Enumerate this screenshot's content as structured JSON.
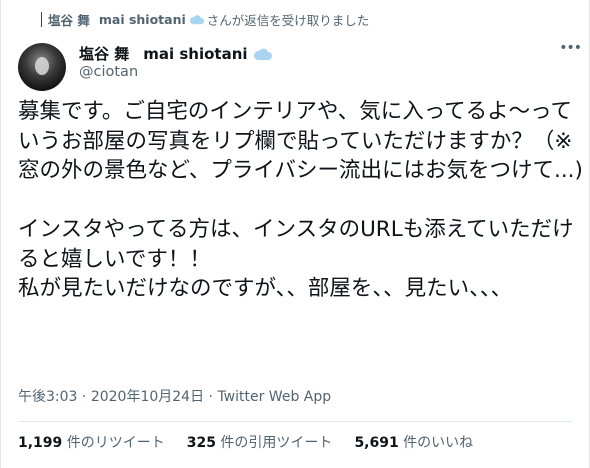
{
  "context": {
    "display_name": "塩谷 舞",
    "username": "mai shiotani",
    "suffix": "さんが返信を受け取りました"
  },
  "tweet": {
    "display_name": "塩谷 舞",
    "username": "mai shiotani",
    "handle": "@ciotan",
    "more_icon": "•••",
    "text": "募集です。ご自宅のインテリアや、気に入ってるよ〜っていうお部屋の写真をリプ欄で貼っていただけますか？（※窓の外の景色など、プライバシー流出にはお気をつけて...)\n\nインスタやってる方は、インスタのURLも添えていただけると嬉しいです！！\n私が見たいだけなのですが、、部屋を、、見たい、、、",
    "time": "午後3:03",
    "separator": "·",
    "date": "2020年10月24日",
    "source": "Twitter Web App"
  },
  "stats": {
    "retweets_count": "1,199",
    "retweets_label": " 件のリツイート",
    "quotes_count": "325",
    "quotes_label": " 件の引用ツイート",
    "likes_count": "5,691",
    "likes_label": " 件のいいね"
  },
  "colors": {
    "accent": "#1da1f2",
    "cloud": "#a8d4f2",
    "muted": "#536471",
    "text": "#0f1419"
  },
  "icons": {
    "username_badge": "cloud-icon",
    "avatar": "user-avatar"
  }
}
